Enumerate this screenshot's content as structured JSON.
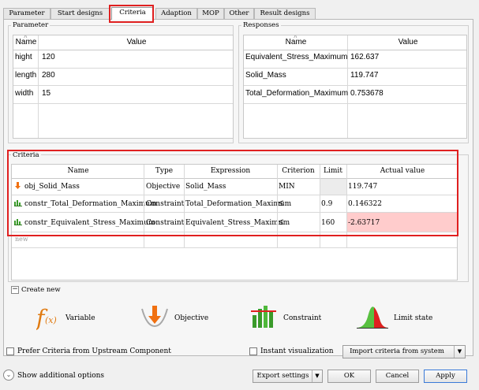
{
  "tabs": [
    {
      "label": "Parameter",
      "active": false
    },
    {
      "label": "Start designs",
      "active": false
    },
    {
      "label": "Criteria",
      "active": true
    },
    {
      "label": "Adaption",
      "active": false
    },
    {
      "label": "MOP",
      "active": false
    },
    {
      "label": "Other",
      "active": false
    },
    {
      "label": "Result designs",
      "active": false
    }
  ],
  "parameter_panel": {
    "title": "Parameter",
    "columns": [
      "Name",
      "Value"
    ],
    "rows": [
      {
        "name": "hight",
        "value": "120"
      },
      {
        "name": "length",
        "value": "280"
      },
      {
        "name": "width",
        "value": "15"
      }
    ]
  },
  "responses_panel": {
    "title": "Responses",
    "columns": [
      "Name",
      "Value"
    ],
    "rows": [
      {
        "name": "Equivalent_Stress_Maximum",
        "value": "162.637"
      },
      {
        "name": "Solid_Mass",
        "value": "119.747"
      },
      {
        "name": "Total_Deformation_Maximum",
        "value": "0.753678"
      }
    ]
  },
  "criteria_panel": {
    "title": "Criteria",
    "columns": [
      "Name",
      "Type",
      "Expression",
      "Criterion",
      "Limit",
      "Actual value"
    ],
    "rows": [
      {
        "icon": "objective-icon",
        "name": "obj_Solid_Mass",
        "type": "Objective",
        "expression": "Solid_Mass",
        "criterion": "MIN",
        "limit": "",
        "actual": "119.747",
        "violated": false
      },
      {
        "icon": "constraint-icon",
        "name": "constr_Total_Deformation_Maximum",
        "type": "Constraint",
        "expression": "Total_Deformation_Maximum",
        "criterion": "≤",
        "limit": "0.9",
        "actual": "0.146322",
        "violated": false
      },
      {
        "icon": "constraint-icon",
        "name": "constr_Equivalent_Stress_Maximum",
        "type": "Constraint",
        "expression": "Equivalent_Stress_Maximum",
        "criterion": "≤",
        "limit": "160",
        "actual": "-2.63717",
        "violated": true
      }
    ],
    "new_row_placeholder": "new",
    "violation_color": "#ffcccc"
  },
  "create_new": {
    "title": "Create new",
    "items": [
      {
        "label": "Variable",
        "icon": "function-icon"
      },
      {
        "label": "Objective",
        "icon": "objective-arrow-icon"
      },
      {
        "label": "Constraint",
        "icon": "constraint-bars-icon"
      },
      {
        "label": "Limit state",
        "icon": "bell-curve-icon"
      }
    ]
  },
  "options": {
    "prefer_criteria_label": "Prefer Criteria from Upstream Component",
    "prefer_criteria_checked": false,
    "instant_visualization_label": "Instant visualization",
    "instant_visualization_checked": false,
    "import_criteria_label": "Import criteria from system"
  },
  "footer": {
    "show_additional_label": "Show additional options",
    "export_settings_label": "Export settings",
    "ok_label": "OK",
    "cancel_label": "Cancel",
    "apply_label": "Apply"
  },
  "colors": {
    "highlight_red": "#e02020",
    "accent_blue": "#2a6cc4",
    "objective_orange": "#f07010",
    "constraint_green": "#3a9a2a"
  }
}
